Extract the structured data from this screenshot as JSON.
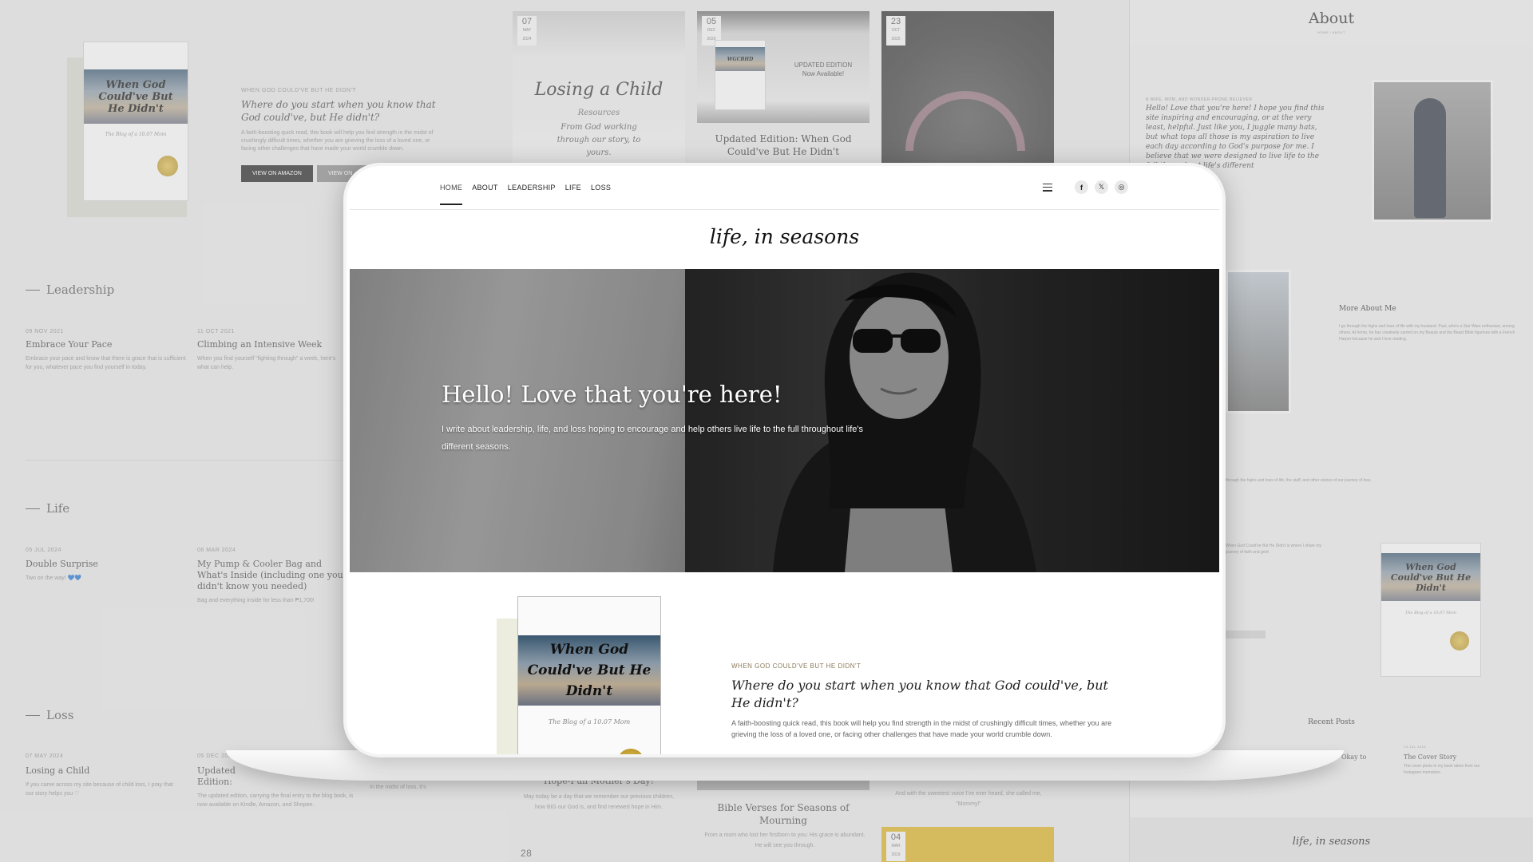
{
  "background": {
    "left_book": {
      "title": "When God Could've But He Didn't",
      "subtitle": "The Blog of a 10.07 Mom"
    },
    "left_feature": {
      "eyebrow": "WHEN GOD COULD'VE BUT HE DIDN'T",
      "heading": "Where do you start when you know that God could've, but He didn't?",
      "body": "A faith-boosting quick read, this book will help you find strength in the midst of crushingly difficult times, whether you are grieving the loss of a loved one, or facing other challenges that have made your world crumble down.",
      "buttons": [
        "VIEW ON AMAZON",
        "VIEW ON"
      ]
    },
    "tiles": [
      {
        "day": "07",
        "month": "MAY",
        "year": "2024",
        "title": "Losing a Child",
        "subtitle": "Resources",
        "quote": "From God working through our story, to yours."
      },
      {
        "day": "05",
        "month": "DEC",
        "year": "2020",
        "title": "Updated Edition: When God Could've But He Didn't",
        "badge": "UPDATED EDITION Now Available!"
      },
      {
        "day": "23",
        "month": "OCT",
        "year": "2020"
      }
    ],
    "sections": {
      "leadership": {
        "label": "Leadership",
        "posts": [
          {
            "date": "09 NOV 2021",
            "title": "Embrace Your Pace",
            "excerpt": "Embrace your pace and know that there is grace that is sufficient for you, whatever pace you find yourself in today."
          },
          {
            "date": "11 OCT 2021",
            "title": "Climbing an Intensive Week",
            "excerpt": "When you find yourself \"fighting through\" a week, here's what can help."
          }
        ]
      },
      "life": {
        "label": "Life",
        "posts": [
          {
            "date": "05 JUL 2024",
            "title": "Double Surprise",
            "excerpt": "Two on the way! 💙💙"
          },
          {
            "date": "06 MAR 2024",
            "title": "My Pump & Cooler Bag and What's Inside (including one you didn't know you needed)",
            "excerpt": "Bag and everything inside for less than ₱1,700!"
          }
        ]
      },
      "loss": {
        "label": "Loss",
        "posts": [
          {
            "date": "07 MAY 2024",
            "title": "Losing a Child",
            "excerpt": "If you came across my site because of child loss, I pray that our story helps you ♡"
          },
          {
            "date": "05 DEC 2020",
            "title": "Updated Edition: When God Could've But He Didn't",
            "excerpt": "The updated edition, carrying the final entry to the blog book, is now available on Kindle, Amazon, and Shopee."
          }
        ]
      }
    },
    "bottom_posts": [
      {
        "title": "Hope-Full Mother's Day!",
        "excerpt": "May today be a day that we remember our precious children, how BIG our God is, and find renewed hope in Him."
      },
      {
        "title": "Bible Verses for Seasons of Mourning",
        "excerpt": "From a mom who lost her firstborn to you: His grace is abundant. He will see you through."
      },
      {
        "excerpt": "And with the sweetest voice I've ever heard, she called me, \"Mommy!\""
      },
      {
        "excerpt": "In the midst of loss, it's"
      }
    ],
    "bottom_dates": [
      {
        "day": "28"
      },
      {
        "day": "04",
        "month": "MAR",
        "year": "2019"
      }
    ],
    "about": {
      "title": "About",
      "breadcrumb": "HOME / ABOUT",
      "intro_eyebrow": "A WIFE, MOM, AND WONDER-PRONE BELIEVER",
      "intro": "Hello! Love that you're here! I hope you find this site inspiring and encouraging, or at the very least, helpful. Just like you, I juggle many hats, but what tops all those is my aspiration to live each day according to God's purpose for me. I believe that we were designed to live life to the full throughout life's different",
      "more_title": "More About Me",
      "more_body": "I go through the highs and lows of life with my husband. Paul, who's a Star Wars enthusiast, among others. At home, he has creatively carried on my Beauty and the Beast Bible figurines with a French Harper because he and I love reading.",
      "footnote": "through the highs and lows of life, the stuff, and other stories of our journey of loss.",
      "book_blurb": "When God Could've But He Didn't is where I share my journey of faith and grief.",
      "book_title": "When God Could've But He Didn't",
      "book_subtitle": "The Blog of a 10.07 Mom",
      "recent_title": "Recent Posts",
      "recent": [
        {
          "title": "Okay to",
          "excerpt": ""
        },
        {
          "date": "13 JUL 2019",
          "title": "The Cover Story",
          "excerpt": "The cover photo in my book taken from our Instagram memories."
        }
      ],
      "footer_brand": "life, in seasons"
    }
  },
  "device": {
    "nav": {
      "links": [
        "HOME",
        "ABOUT",
        "LEADERSHIP",
        "LIFE",
        "LOSS"
      ],
      "active": "HOME",
      "social": [
        "f",
        "𝕏",
        "◎"
      ]
    },
    "brand": "life, in seasons",
    "hero": {
      "heading": "Hello! Love that you're here!",
      "body": "I write about leadership, life, and loss hoping to encourage and help others live life to the full throughout life's different seasons."
    },
    "featured": {
      "eyebrow": "WHEN GOD COULD'VE BUT HE DIDN'T",
      "heading": "Where do you start when you know that God could've, but He didn't?",
      "body": "A faith-boosting quick read, this book will help you find strength in the midst of crushingly difficult times, whether you are grieving the loss of a loved one, or facing other challenges that have made your world crumble down.",
      "book_title": "When God Could've But He Didn't",
      "book_subtitle": "The Blog of a 10.07 Mom"
    }
  },
  "colors": {
    "accent": "#222222",
    "eyebrow": "#8a7a5a",
    "background": "#e4e4e4"
  }
}
